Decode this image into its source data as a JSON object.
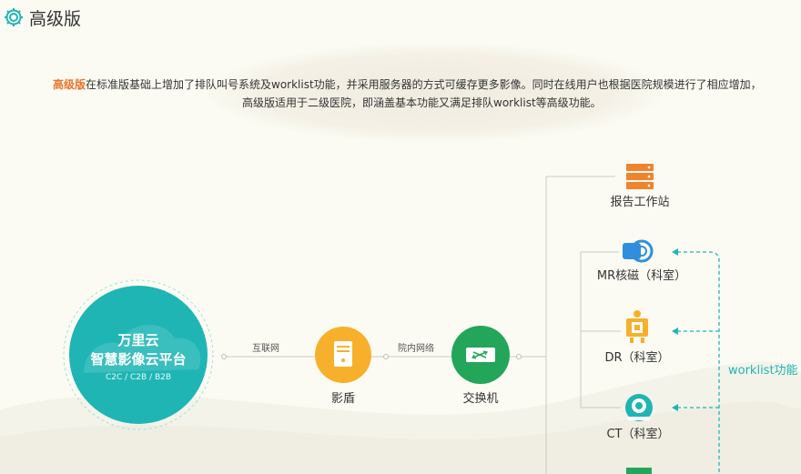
{
  "header": {
    "title": "高级版"
  },
  "intro": {
    "highlight": "高级版",
    "line1_rest": "在标准版基础上增加了排队叫号系统及worklist功能，并采用服务器的方式可缓存更多影像。同时在线用户也根据医院规模进行了相应增加，",
    "line2": "高级版适用于二级医院，即涵盖基本功能又满足排队worklist等高级功能。"
  },
  "platform": {
    "name": "万里云",
    "subtitle": "智慧影像云平台",
    "modes": "C2C / C2B / B2B"
  },
  "connections": {
    "internet": "互联网",
    "hospital_network": "院内网络"
  },
  "nodes": {
    "shield": "影盾",
    "switch": "交换机",
    "report": "报告工作站",
    "mr": "MR核磁（科室）",
    "dr": "DR（科室）",
    "ct": "CT（科室）"
  },
  "worklist_label": "worklist功能",
  "colors": {
    "platform": "#1fb5b5",
    "shield": "#f7b02b",
    "switch": "#23a55a",
    "report": "#f0832d",
    "mr": "#2f8fdc",
    "dr": "#f7b02b",
    "ct": "#1fb5b5",
    "highlight": "#e8752a"
  }
}
